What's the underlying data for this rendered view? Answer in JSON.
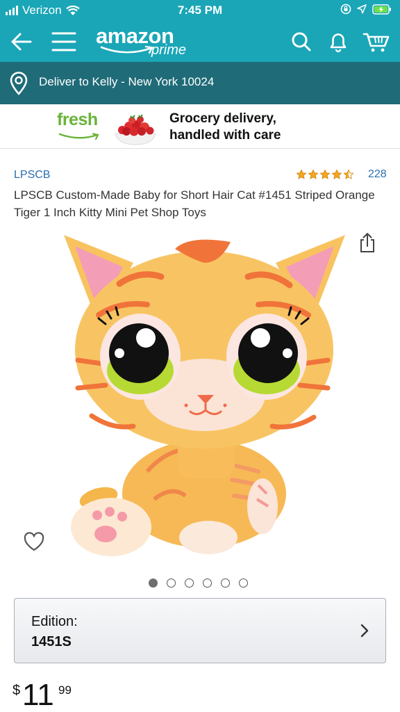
{
  "status_bar": {
    "carrier": "Verizon",
    "time": "7:45 PM"
  },
  "header": {
    "logo_text": "amazon",
    "logo_sub": "prime",
    "brand_color": "#1aa6b7",
    "icons": [
      "back-arrow-icon",
      "hamburger-menu-icon",
      "search-icon",
      "bell-icon",
      "cart-icon"
    ]
  },
  "delivery": {
    "text": "Deliver to Kelly - New York 10024",
    "icon": "location-pin-icon",
    "bar_color": "#1f6b78"
  },
  "fresh_banner": {
    "logo": "fresh",
    "tagline_line1": "Grocery delivery,",
    "tagline_line2": "handled with care"
  },
  "product": {
    "brand": "LPSCB",
    "rating_stars": 4.5,
    "rating_count": "228",
    "title": "LPSCB Custom-Made Baby for Short Hair Cat #1451 Striped Orange Tiger 1 Inch Kitty Mini Pet Shop Toys",
    "image_count": 6,
    "active_image": 1
  },
  "edition": {
    "label": "Edition:",
    "value": "1451S"
  },
  "price": {
    "symbol": "$",
    "whole": "11",
    "fraction": "99"
  }
}
